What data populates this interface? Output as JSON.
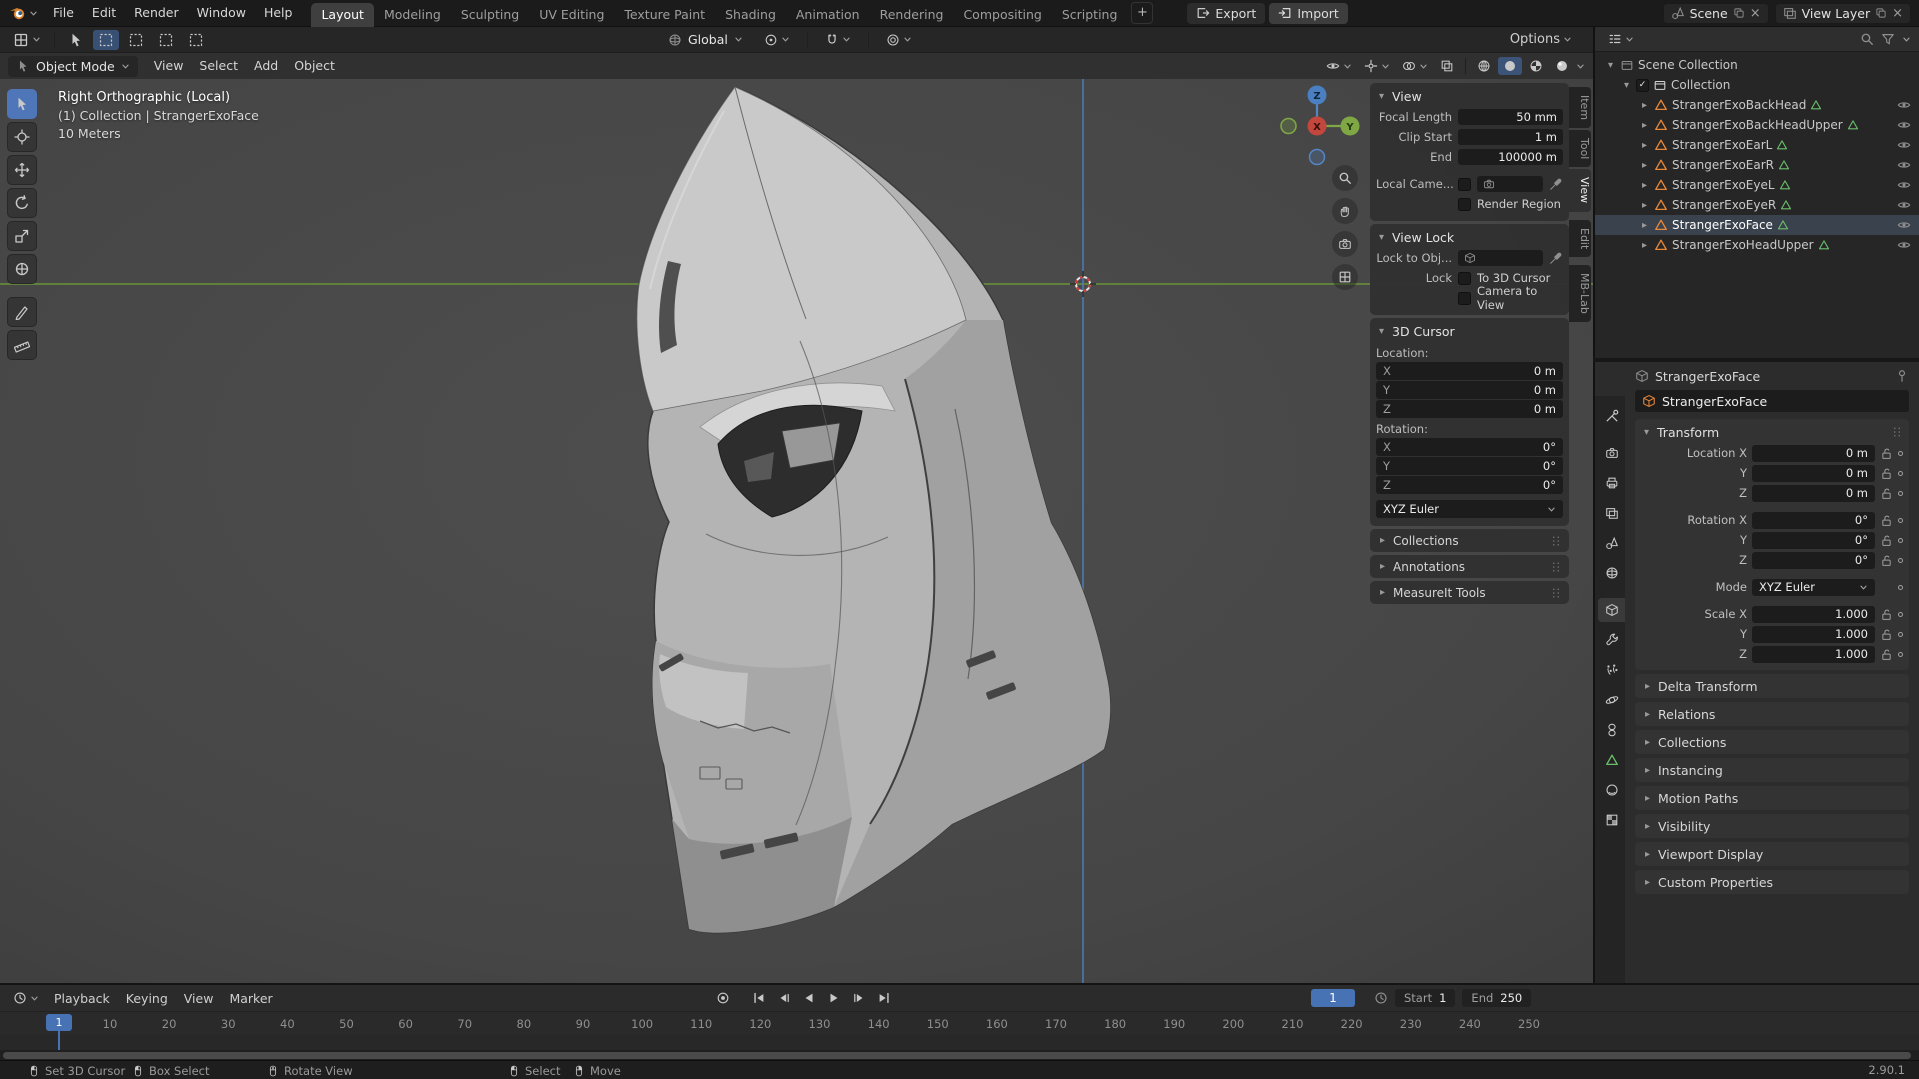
{
  "colors": {
    "accent_blue": "#4772b3",
    "object_orange": "#e8883a",
    "mesh_data_green": "#6bbf6b",
    "axis_y_green": "#6d9b37",
    "axis_z_blue": "#4a7fc1"
  },
  "icons": {
    "chevron_down": "▾",
    "expand_right": "▸",
    "checkbox_check": "✓"
  },
  "topbar": {
    "menus": [
      "File",
      "Edit",
      "Render",
      "Window",
      "Help"
    ],
    "workspaces": [
      "Layout",
      "Modeling",
      "Sculpting",
      "UV Editing",
      "Texture Paint",
      "Shading",
      "Animation",
      "Rendering",
      "Compositing",
      "Scripting"
    ],
    "active_workspace": "Layout",
    "add_workspace_label": "+",
    "export_label": "Export",
    "import_label": "Import",
    "scene_name": "Scene",
    "view_layer_name": "View Layer"
  },
  "tool_settings": {
    "orientation_value": "Global",
    "options_label": "Options"
  },
  "viewport_header": {
    "mode_value": "Object Mode",
    "menus": [
      "View",
      "Select",
      "Add",
      "Object"
    ]
  },
  "viewport": {
    "overlay_line1": "Right Orthographic (Local)",
    "overlay_line2": "(1) Collection | StrangerExoFace",
    "overlay_line3": "10 Meters",
    "gizmo_axes": {
      "x": "X",
      "y": "Y",
      "z": "Z"
    }
  },
  "sidebar": {
    "tabs": [
      "Item",
      "Tool",
      "View",
      "Edit",
      "MB-Lab"
    ],
    "active_tab": "View",
    "view_panel": {
      "title": "View",
      "rows": [
        {
          "label": "Focal Length",
          "value": "50 mm"
        },
        {
          "label": "Clip Start",
          "value": "1 m"
        },
        {
          "label": "End",
          "value": "100000 m"
        }
      ],
      "local_camera_label": "Local Came...",
      "render_region_label": "Render Region"
    },
    "view_lock_panel": {
      "title": "View Lock",
      "lock_to_object_label": "Lock to Obj...",
      "lock_label": "Lock",
      "to_3d_cursor_label": "To 3D Cursor",
      "camera_to_view_label": "Camera to View"
    },
    "cursor_panel": {
      "title": "3D Cursor",
      "location_label": "Location:",
      "rotation_label": "Rotation:",
      "location": [
        {
          "axis": "X",
          "value": "0 m"
        },
        {
          "axis": "Y",
          "value": "0 m"
        },
        {
          "axis": "Z",
          "value": "0 m"
        }
      ],
      "rotation": [
        {
          "axis": "X",
          "value": "0°"
        },
        {
          "axis": "Y",
          "value": "0°"
        },
        {
          "axis": "Z",
          "value": "0°"
        }
      ],
      "euler_mode": "XYZ Euler"
    },
    "collapsed_panels": [
      "Collections",
      "Annotations",
      "MeasureIt Tools"
    ]
  },
  "outliner": {
    "scene_collection_label": "Scene Collection",
    "collection_label": "Collection",
    "objects": [
      "StrangerExoBackHead",
      "StrangerExoBackHeadUpper",
      "StrangerExoEarL",
      "StrangerExoEarR",
      "StrangerExoEyeL",
      "StrangerExoEyeR",
      "StrangerExoFace",
      "StrangerExoHeadUpper"
    ],
    "active_object": "StrangerExoFace"
  },
  "properties": {
    "breadcrumb_object": "StrangerExoFace",
    "object_name": "StrangerExoFace",
    "transform_panel": {
      "title": "Transform",
      "rows": [
        {
          "label": "Location X",
          "value": "0 m"
        },
        {
          "label": "Y",
          "value": "0 m"
        },
        {
          "label": "Z",
          "value": "0 m"
        },
        {
          "label": "Rotation X",
          "value": "0°"
        },
        {
          "label": "Y",
          "value": "0°"
        },
        {
          "label": "Z",
          "value": "0°"
        },
        {
          "label": "Mode",
          "value": "XYZ Euler"
        },
        {
          "label": "Scale X",
          "value": "1.000"
        },
        {
          "label": "Y",
          "value": "1.000"
        },
        {
          "label": "Z",
          "value": "1.000"
        }
      ]
    },
    "collapsed_panels": [
      "Delta Transform",
      "Relations",
      "Collections",
      "Instancing",
      "Motion Paths",
      "Visibility",
      "Viewport Display",
      "Custom Properties"
    ]
  },
  "timeline": {
    "menus": [
      "Playback",
      "Keying",
      "View",
      "Marker"
    ],
    "current_frame": "1",
    "playhead_label": "1",
    "start_label": "Start",
    "start_value": "1",
    "end_label": "End",
    "end_value": "250",
    "ticks": [
      10,
      20,
      30,
      40,
      50,
      60,
      70,
      80,
      90,
      100,
      110,
      120,
      130,
      140,
      150,
      160,
      170,
      180,
      190,
      200,
      210,
      220,
      230,
      240,
      250
    ]
  },
  "statusbar": {
    "hints": [
      "Set 3D Cursor",
      "Box Select",
      "Rotate View",
      "Select",
      "Move"
    ],
    "version": "2.90.1"
  }
}
